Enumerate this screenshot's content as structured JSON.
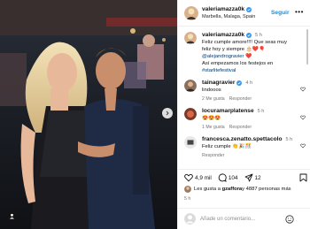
{
  "post": {
    "username": "valeriamazza0k",
    "location": "Marbella, Malaga, Spain",
    "follow_label": "Seguir",
    "more_label": "•••"
  },
  "comments": [
    {
      "username": "valeriamazza0k",
      "time": "5 h",
      "text_lines": [
        "Feliz cumple amore!!!! Que seas muy",
        "feliz hoy y siempre 🎂❤️🎈"
      ],
      "link_text": "@alejandrogravier",
      "text_after_link": " ❤️",
      "last_line_plain": "Así empezamos los festejos en",
      "hashtag": "#starlitefestival"
    },
    {
      "username": "tainagravier",
      "time": "4 h",
      "text": "lindooos",
      "likes": "2 Me gusta",
      "reply": "Responder"
    },
    {
      "username": "locuramarplatense",
      "time": "5 h",
      "text": "😍😍😍",
      "likes": "1 Me gusta",
      "reply": "Responder"
    },
    {
      "username": "francesca.zenatto.spettacolo",
      "time": "5 h",
      "text": "Feliz cumple 👏🎉🎊",
      "likes": "",
      "reply": "Responder"
    }
  ],
  "actions": {
    "likes_count": "4,9 mil",
    "comments_count": "104",
    "shares_count": "12",
    "liked_by_prefix": "Les gusta a",
    "liked_by_user": "gzaffora",
    "liked_by_suffix": " y 4887 personas más",
    "date": "5 h"
  },
  "add_comment": {
    "placeholder": "Añade un comentario..."
  },
  "colors": {
    "accent": "#0095f6",
    "verified": "#3897f0",
    "link": "#00376b",
    "muted": "#737373"
  },
  "icons": [
    "next-photo-icon",
    "user-tag-icon",
    "verified-icon",
    "more-options-icon",
    "heart-icon",
    "comment-icon",
    "share-icon",
    "bookmark-icon",
    "emoji-icon"
  ]
}
